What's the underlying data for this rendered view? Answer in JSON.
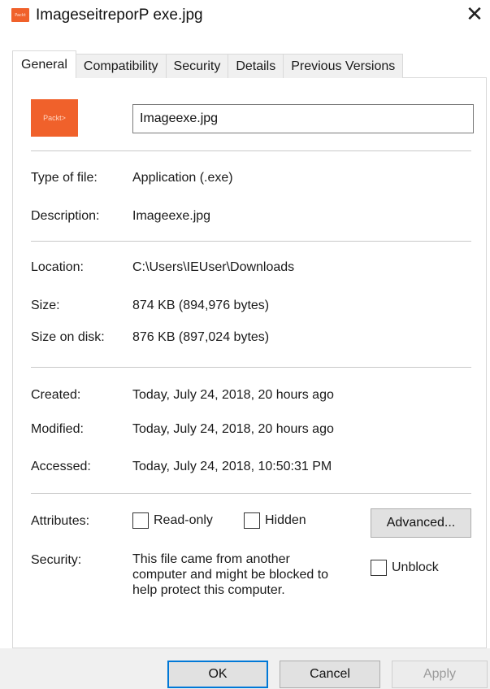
{
  "window": {
    "title": "ImageseitreporP exe.jpg",
    "close_glyph": "✕",
    "app_icon_text": "Packt"
  },
  "tabs": [
    {
      "label": "General",
      "active": true
    },
    {
      "label": "Compatibility",
      "active": false
    },
    {
      "label": "Security",
      "active": false
    },
    {
      "label": "Details",
      "active": false
    },
    {
      "label": "Previous Versions",
      "active": false
    }
  ],
  "general": {
    "icon_text": "Packt>",
    "file_name": "Imageexe.jpg",
    "type_of_file": {
      "label": "Type of file:",
      "value": "Application (.exe)"
    },
    "description": {
      "label": "Description:",
      "value": "Imageexe.jpg"
    },
    "location": {
      "label": "Location:",
      "value": "C:\\Users\\IEUser\\Downloads"
    },
    "size": {
      "label": "Size:",
      "value": "874 KB (894,976 bytes)"
    },
    "size_on_disk": {
      "label": "Size on disk:",
      "value": "876 KB (897,024 bytes)"
    },
    "created": {
      "label": "Created:",
      "value": "Today, July 24, 2018, 20 hours ago"
    },
    "modified": {
      "label": "Modified:",
      "value": "Today, July 24, 2018, 20 hours ago"
    },
    "accessed": {
      "label": "Accessed:",
      "value": "Today, July 24, 2018, 10:50:31 PM"
    },
    "attributes": {
      "label": "Attributes:",
      "read_only": "Read-only",
      "hidden": "Hidden",
      "advanced_button": "Advanced..."
    },
    "security": {
      "label": "Security:",
      "line1": "This file came from another",
      "line2": "computer and might be blocked to",
      "line3": "help protect this computer.",
      "unblock": "Unblock"
    }
  },
  "buttons": {
    "ok": "OK",
    "cancel": "Cancel",
    "apply": "Apply"
  },
  "colors": {
    "accent": "#0078d7",
    "app_icon": "#f0612b"
  }
}
